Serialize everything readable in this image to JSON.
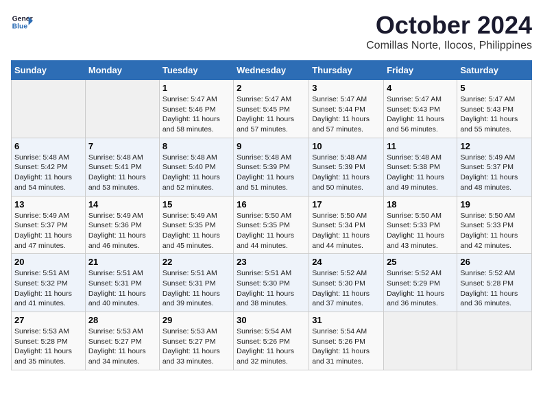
{
  "logo": {
    "line1": "General",
    "line2": "Blue"
  },
  "title": "October 2024",
  "subtitle": "Comillas Norte, Ilocos, Philippines",
  "days_of_week": [
    "Sunday",
    "Monday",
    "Tuesday",
    "Wednesday",
    "Thursday",
    "Friday",
    "Saturday"
  ],
  "weeks": [
    [
      {
        "day": "",
        "sunrise": "",
        "sunset": "",
        "daylight": ""
      },
      {
        "day": "",
        "sunrise": "",
        "sunset": "",
        "daylight": ""
      },
      {
        "day": "1",
        "sunrise": "Sunrise: 5:47 AM",
        "sunset": "Sunset: 5:46 PM",
        "daylight": "Daylight: 11 hours and 58 minutes."
      },
      {
        "day": "2",
        "sunrise": "Sunrise: 5:47 AM",
        "sunset": "Sunset: 5:45 PM",
        "daylight": "Daylight: 11 hours and 57 minutes."
      },
      {
        "day": "3",
        "sunrise": "Sunrise: 5:47 AM",
        "sunset": "Sunset: 5:44 PM",
        "daylight": "Daylight: 11 hours and 57 minutes."
      },
      {
        "day": "4",
        "sunrise": "Sunrise: 5:47 AM",
        "sunset": "Sunset: 5:43 PM",
        "daylight": "Daylight: 11 hours and 56 minutes."
      },
      {
        "day": "5",
        "sunrise": "Sunrise: 5:47 AM",
        "sunset": "Sunset: 5:43 PM",
        "daylight": "Daylight: 11 hours and 55 minutes."
      }
    ],
    [
      {
        "day": "6",
        "sunrise": "Sunrise: 5:48 AM",
        "sunset": "Sunset: 5:42 PM",
        "daylight": "Daylight: 11 hours and 54 minutes."
      },
      {
        "day": "7",
        "sunrise": "Sunrise: 5:48 AM",
        "sunset": "Sunset: 5:41 PM",
        "daylight": "Daylight: 11 hours and 53 minutes."
      },
      {
        "day": "8",
        "sunrise": "Sunrise: 5:48 AM",
        "sunset": "Sunset: 5:40 PM",
        "daylight": "Daylight: 11 hours and 52 minutes."
      },
      {
        "day": "9",
        "sunrise": "Sunrise: 5:48 AM",
        "sunset": "Sunset: 5:39 PM",
        "daylight": "Daylight: 11 hours and 51 minutes."
      },
      {
        "day": "10",
        "sunrise": "Sunrise: 5:48 AM",
        "sunset": "Sunset: 5:39 PM",
        "daylight": "Daylight: 11 hours and 50 minutes."
      },
      {
        "day": "11",
        "sunrise": "Sunrise: 5:48 AM",
        "sunset": "Sunset: 5:38 PM",
        "daylight": "Daylight: 11 hours and 49 minutes."
      },
      {
        "day": "12",
        "sunrise": "Sunrise: 5:49 AM",
        "sunset": "Sunset: 5:37 PM",
        "daylight": "Daylight: 11 hours and 48 minutes."
      }
    ],
    [
      {
        "day": "13",
        "sunrise": "Sunrise: 5:49 AM",
        "sunset": "Sunset: 5:37 PM",
        "daylight": "Daylight: 11 hours and 47 minutes."
      },
      {
        "day": "14",
        "sunrise": "Sunrise: 5:49 AM",
        "sunset": "Sunset: 5:36 PM",
        "daylight": "Daylight: 11 hours and 46 minutes."
      },
      {
        "day": "15",
        "sunrise": "Sunrise: 5:49 AM",
        "sunset": "Sunset: 5:35 PM",
        "daylight": "Daylight: 11 hours and 45 minutes."
      },
      {
        "day": "16",
        "sunrise": "Sunrise: 5:50 AM",
        "sunset": "Sunset: 5:35 PM",
        "daylight": "Daylight: 11 hours and 44 minutes."
      },
      {
        "day": "17",
        "sunrise": "Sunrise: 5:50 AM",
        "sunset": "Sunset: 5:34 PM",
        "daylight": "Daylight: 11 hours and 44 minutes."
      },
      {
        "day": "18",
        "sunrise": "Sunrise: 5:50 AM",
        "sunset": "Sunset: 5:33 PM",
        "daylight": "Daylight: 11 hours and 43 minutes."
      },
      {
        "day": "19",
        "sunrise": "Sunrise: 5:50 AM",
        "sunset": "Sunset: 5:33 PM",
        "daylight": "Daylight: 11 hours and 42 minutes."
      }
    ],
    [
      {
        "day": "20",
        "sunrise": "Sunrise: 5:51 AM",
        "sunset": "Sunset: 5:32 PM",
        "daylight": "Daylight: 11 hours and 41 minutes."
      },
      {
        "day": "21",
        "sunrise": "Sunrise: 5:51 AM",
        "sunset": "Sunset: 5:31 PM",
        "daylight": "Daylight: 11 hours and 40 minutes."
      },
      {
        "day": "22",
        "sunrise": "Sunrise: 5:51 AM",
        "sunset": "Sunset: 5:31 PM",
        "daylight": "Daylight: 11 hours and 39 minutes."
      },
      {
        "day": "23",
        "sunrise": "Sunrise: 5:51 AM",
        "sunset": "Sunset: 5:30 PM",
        "daylight": "Daylight: 11 hours and 38 minutes."
      },
      {
        "day": "24",
        "sunrise": "Sunrise: 5:52 AM",
        "sunset": "Sunset: 5:30 PM",
        "daylight": "Daylight: 11 hours and 37 minutes."
      },
      {
        "day": "25",
        "sunrise": "Sunrise: 5:52 AM",
        "sunset": "Sunset: 5:29 PM",
        "daylight": "Daylight: 11 hours and 36 minutes."
      },
      {
        "day": "26",
        "sunrise": "Sunrise: 5:52 AM",
        "sunset": "Sunset: 5:28 PM",
        "daylight": "Daylight: 11 hours and 36 minutes."
      }
    ],
    [
      {
        "day": "27",
        "sunrise": "Sunrise: 5:53 AM",
        "sunset": "Sunset: 5:28 PM",
        "daylight": "Daylight: 11 hours and 35 minutes."
      },
      {
        "day": "28",
        "sunrise": "Sunrise: 5:53 AM",
        "sunset": "Sunset: 5:27 PM",
        "daylight": "Daylight: 11 hours and 34 minutes."
      },
      {
        "day": "29",
        "sunrise": "Sunrise: 5:53 AM",
        "sunset": "Sunset: 5:27 PM",
        "daylight": "Daylight: 11 hours and 33 minutes."
      },
      {
        "day": "30",
        "sunrise": "Sunrise: 5:54 AM",
        "sunset": "Sunset: 5:26 PM",
        "daylight": "Daylight: 11 hours and 32 minutes."
      },
      {
        "day": "31",
        "sunrise": "Sunrise: 5:54 AM",
        "sunset": "Sunset: 5:26 PM",
        "daylight": "Daylight: 11 hours and 31 minutes."
      },
      {
        "day": "",
        "sunrise": "",
        "sunset": "",
        "daylight": ""
      },
      {
        "day": "",
        "sunrise": "",
        "sunset": "",
        "daylight": ""
      }
    ]
  ]
}
